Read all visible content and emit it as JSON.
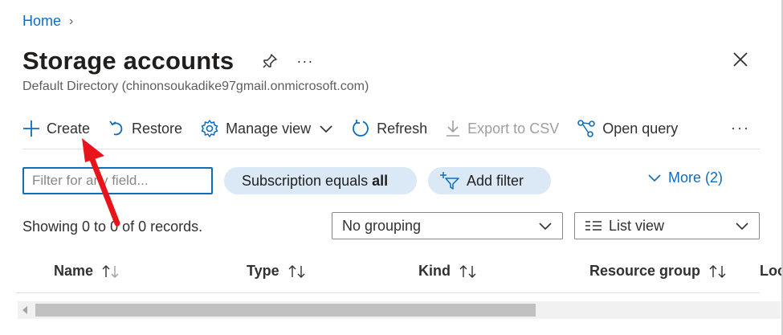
{
  "breadcrumb": {
    "home": "Home",
    "separator": "›"
  },
  "page": {
    "title": "Storage accounts",
    "ellipsis": "···",
    "subtitle": "Default Directory (chinonsoukadike97gmail.onmicrosoft.com)"
  },
  "toolbar": {
    "create": "Create",
    "restore": "Restore",
    "manage_view": "Manage view",
    "refresh": "Refresh",
    "export_csv": "Export to CSV",
    "open_query": "Open query",
    "more": "···"
  },
  "filters": {
    "search_placeholder": "Filter for any field...",
    "subscription_prefix": "Subscription equals",
    "subscription_value": "all",
    "add_filter": "Add filter",
    "more": "More (2)"
  },
  "records": "Showing 0 to 0 of 0 records.",
  "grouping": {
    "selected": "No grouping"
  },
  "view": {
    "selected": "List view"
  },
  "table": {
    "columns": [
      "Name",
      "Type",
      "Kind",
      "Resource group",
      "Loc"
    ],
    "rows": []
  },
  "colors": {
    "accent": "#0f6cbd",
    "pill": "#dbe8f6",
    "annotation_arrow": "#e8141c"
  }
}
